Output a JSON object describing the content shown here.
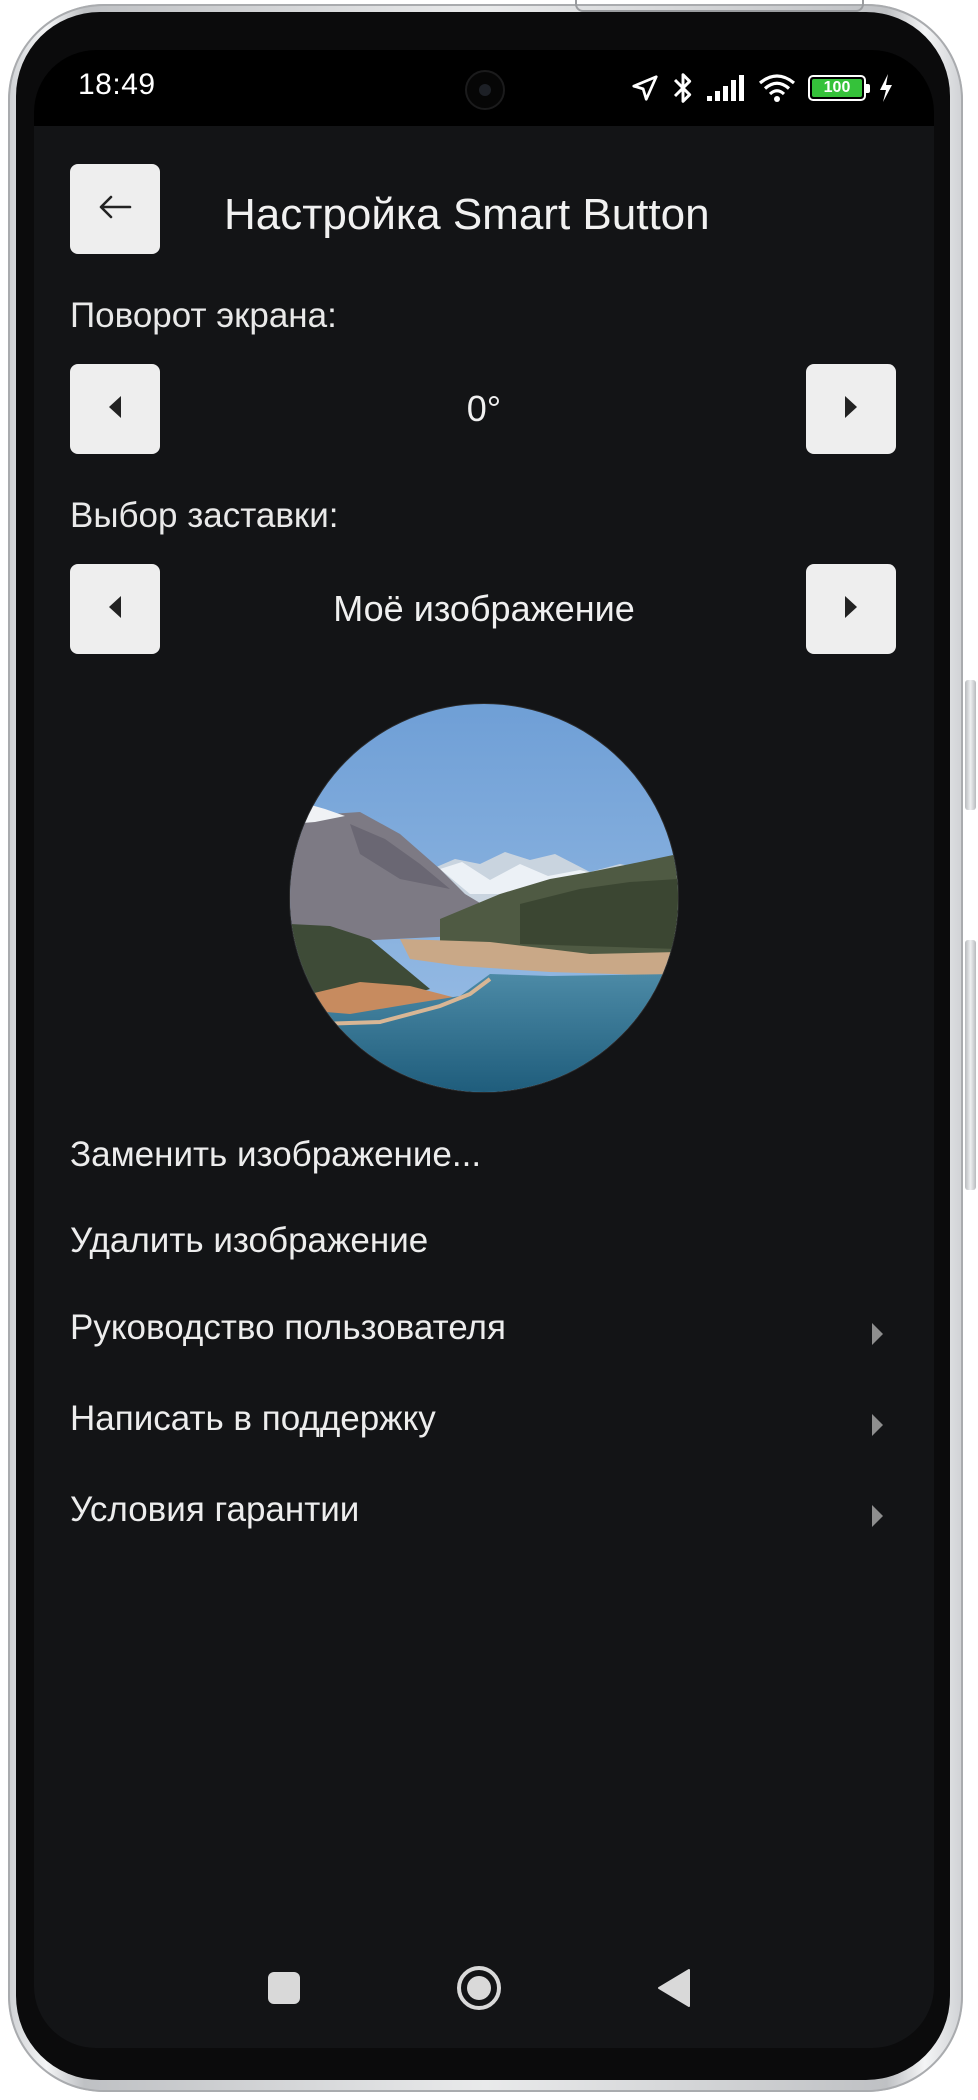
{
  "status_bar": {
    "time": "18:49",
    "battery_level": "100",
    "battery_fraction": 1.0,
    "battery_color": "#35c23a",
    "icons": [
      "location-arrow-icon",
      "bluetooth-icon",
      "signal-icon",
      "wifi-icon",
      "battery-icon",
      "charging-icon"
    ]
  },
  "header": {
    "back_icon": "arrow-left-icon",
    "title": "Настройка Smart Button"
  },
  "rotation": {
    "label": "Поворот экрана:",
    "value": "0°",
    "prev_icon": "triangle-left-icon",
    "next_icon": "triangle-right-icon"
  },
  "screensaver": {
    "label": "Выбор заставки:",
    "value": "Моё изображение",
    "prev_icon": "triangle-left-icon",
    "next_icon": "triangle-right-icon"
  },
  "preview": {
    "image": "mountain-lake-photo"
  },
  "menu": {
    "items": [
      {
        "label": "Заменить изображение...",
        "has_arrow": false
      },
      {
        "label": "Удалить изображение",
        "has_arrow": false
      },
      {
        "label": "Руководство пользователя",
        "has_arrow": true
      },
      {
        "label": "Написать в поддержку",
        "has_arrow": true
      },
      {
        "label": "Условия гарантии",
        "has_arrow": true
      }
    ]
  },
  "nav_bar": {
    "buttons": [
      "recents-square-icon",
      "home-circle-icon",
      "back-triangle-icon"
    ]
  },
  "colors": {
    "background": "#131416",
    "button_bg": "#eeeeee",
    "text": "#ececec"
  }
}
